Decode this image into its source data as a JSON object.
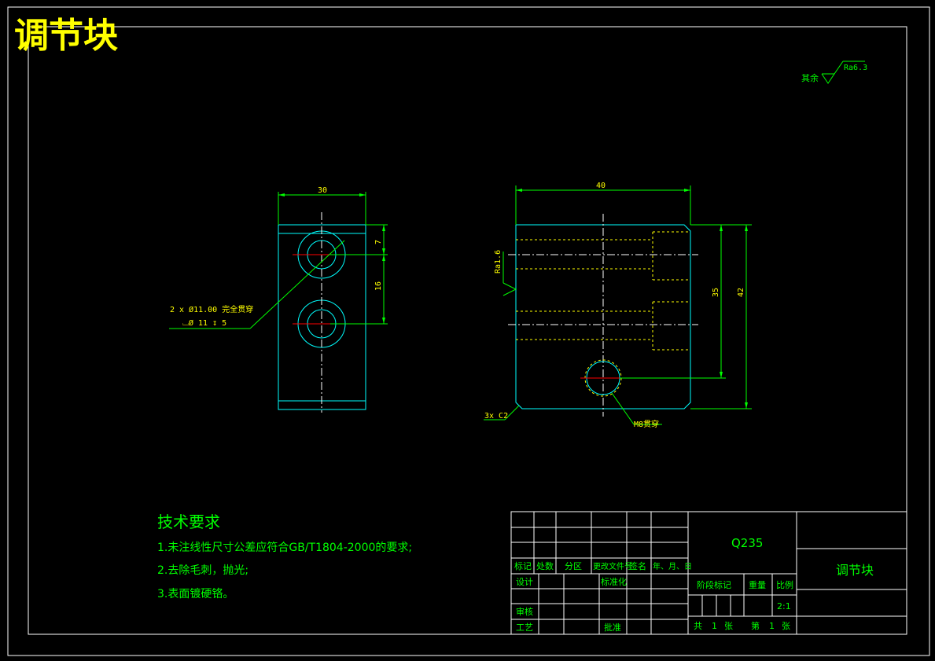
{
  "drawing": {
    "title": "调节块",
    "surface_finish_note": {
      "label": "其余",
      "value": "Ra6.3"
    },
    "left_view": {
      "dim_width": "30",
      "dim_top": "7",
      "dim_spacing": "16",
      "hole_note_line1": "2 x Ø11.00 完全贯穿",
      "hole_note_line2": "⌴Ø 11 ↧ 5"
    },
    "right_view": {
      "dim_width": "40",
      "dim_inner_height": "35",
      "dim_total_height": "42",
      "roughness": "Ra1.6",
      "chamfer": "3x C2",
      "thread": "M8贯穿"
    },
    "tech_requirements": {
      "heading": "技术要求",
      "items": [
        "1.未注线性尺寸公差应符合GB/T1804-2000的要求;",
        "2.去除毛刺，抛光;",
        "3.表面镀硬铬。"
      ]
    },
    "title_block": {
      "material": "Q235",
      "part_name": "调节块",
      "headers": [
        "标记",
        "处数",
        "分区",
        "更改文件号",
        "签名",
        "年、月、日"
      ],
      "design": "设计",
      "standardize": "标准化",
      "review": "审核",
      "process": "工艺",
      "approve": "批准",
      "stage_mark": "阶段标记",
      "weight": "重量",
      "scale": "比例",
      "scale_value": "2:1",
      "total_label": "共",
      "total_value": "1",
      "sheet_unit": "张",
      "sheet_label": "第",
      "sheet_value": "1",
      "sheet_unit2": "张"
    }
  },
  "colors": {
    "background": "#000000",
    "frame": "#ffffff",
    "outline": "#00ffff",
    "dimension": "#00ff00",
    "hidden": "#ffff00",
    "title": "#ffff00",
    "center_mark": "#ff0000"
  }
}
